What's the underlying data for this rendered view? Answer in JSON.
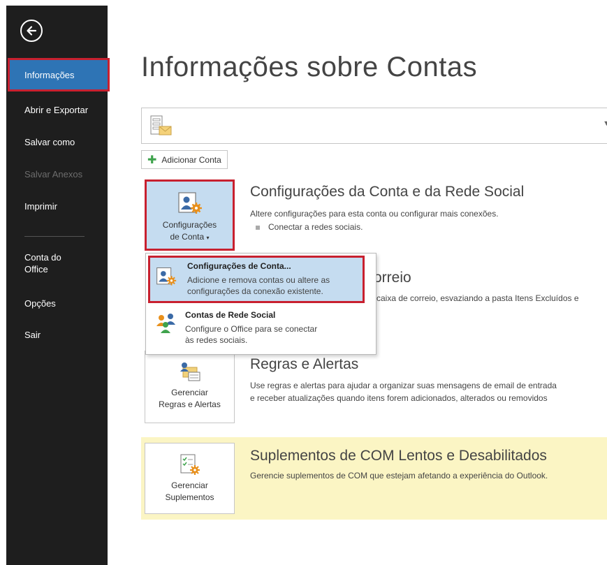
{
  "sidebar": {
    "items": [
      {
        "label": "Informações",
        "state": "selected"
      },
      {
        "label": "Abrir e Exportar",
        "state": "normal"
      },
      {
        "label": "Salvar como",
        "state": "normal"
      },
      {
        "label": "Salvar Anexos",
        "state": "disabled"
      },
      {
        "label": "Imprimir",
        "state": "normal"
      },
      {
        "label": "Conta do Office",
        "state": "normal"
      },
      {
        "label": "Opções",
        "state": "normal"
      },
      {
        "label": "Sair",
        "state": "normal"
      }
    ],
    "back_icon": "back-arrow-icon"
  },
  "main": {
    "title": "Informações sobre Contas",
    "account_selector": {
      "value": "",
      "icon": "email-account-icon"
    },
    "add_account_label": "Adicionar Conta",
    "sections": {
      "account_settings": {
        "tile_label_line1": "Configurações",
        "tile_label_line2": "de Conta",
        "title": "Configurações da Conta e da Rede Social",
        "description": "Altere configurações para esta conta ou configurar mais conexões.",
        "bullet": "Conectar a redes sociais."
      },
      "mailbox": {
        "title_visible": "orreio",
        "description_visible": "caixa de correio, esvaziando a pasta Itens Excluídos e"
      },
      "rules": {
        "tile_label_line1": "Gerenciar",
        "tile_label_line2": "Regras e Alertas",
        "title": "Regras e Alertas",
        "description_line1": "Use regras e alertas para ajudar a organizar suas mensagens de email de entrada",
        "description_line2": "e receber atualizações quando itens forem adicionados, alterados ou removidos"
      },
      "addins": {
        "tile_label_line1": "Gerenciar",
        "tile_label_line2": "Suplementos",
        "title": "Suplementos de COM Lentos e Desabilitados",
        "description": "Gerencie suplementos de COM que estejam afetando a experiência do Outlook."
      }
    }
  },
  "dropdown": {
    "items": [
      {
        "title": "Configurações de Conta...",
        "desc_line1": "Adicione e remova contas ou altere as",
        "desc_line2": "configurações da conexão existente.",
        "highlighted": true
      },
      {
        "title": "Contas de Rede Social",
        "desc_line1": "Configure o Office para se conectar",
        "desc_line2": "às redes sociais.",
        "highlighted": false
      }
    ]
  },
  "colors": {
    "sidebar_bg": "#1e1e1e",
    "selected_bg": "#2e74b5",
    "highlight_border": "#c8202f",
    "tile_selected_bg": "#c5dcf0",
    "band_yellow": "#fbf5c4"
  }
}
